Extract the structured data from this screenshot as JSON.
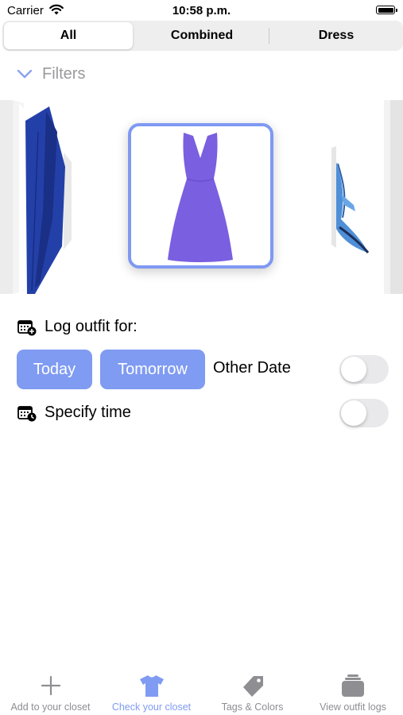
{
  "status_bar": {
    "carrier": "Carrier",
    "time": "10:58 p.m."
  },
  "segments": {
    "items": [
      "All",
      "Combined",
      "Dress"
    ],
    "selected": "All"
  },
  "filters": {
    "label": "Filters"
  },
  "carousel": {
    "items": [
      "blue-jeans",
      "purple-dress",
      "blue-shoe"
    ],
    "selected": "purple-dress",
    "colors": {
      "jeans": "#2340a8",
      "dress": "#7a5fe0",
      "shoe": "#4f8fd8",
      "selection_border": "#7f99f2"
    }
  },
  "log": {
    "title": "Log outfit for:",
    "today": "Today",
    "tomorrow": "Tomorrow",
    "other_date": "Other Date",
    "specify_time": "Specify time",
    "other_date_enabled": false,
    "specify_time_enabled": false
  },
  "tabbar": {
    "items": [
      {
        "label": "Add to your closet",
        "icon": "plus-icon"
      },
      {
        "label": "Check your closet",
        "icon": "tshirt-icon"
      },
      {
        "label": "Tags & Colors",
        "icon": "tag-icon"
      },
      {
        "label": "View outfit logs",
        "icon": "stack-icon"
      }
    ],
    "active": "Check your closet"
  },
  "colors": {
    "accent": "#7f9bf2",
    "inactive": "#8e8e93",
    "toggle_off": "#e9e9eb"
  }
}
